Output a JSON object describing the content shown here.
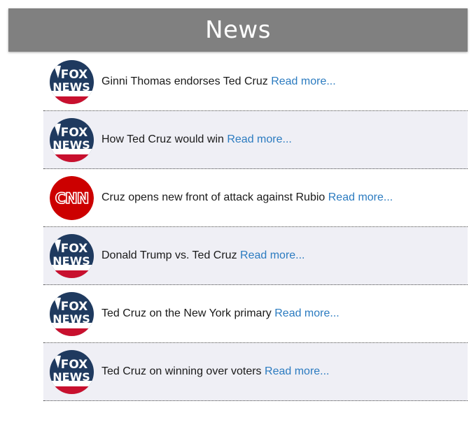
{
  "header": {
    "title": "News"
  },
  "news": [
    {
      "source": "fox-news-logo",
      "headline": "Ginni Thomas endorses Ted Cruz",
      "link_label": "Read more..."
    },
    {
      "source": "fox-news-logo",
      "headline": "How Ted Cruz would win",
      "link_label": "Read more..."
    },
    {
      "source": "cnn-logo",
      "headline": "Cruz opens new front of attack against Rubio",
      "link_label": "Read more..."
    },
    {
      "source": "fox-news-logo",
      "headline": "Donald Trump vs. Ted Cruz",
      "link_label": "Read more..."
    },
    {
      "source": "fox-news-logo",
      "headline": "Ted Cruz on the New York primary",
      "link_label": "Read more..."
    },
    {
      "source": "fox-news-logo",
      "headline": "Ted Cruz on winning over voters",
      "link_label": "Read more..."
    }
  ],
  "logos": {
    "fox": {
      "text_top": "FOX",
      "text_bottom": "NEWS",
      "bg": "#1f3a5f",
      "accent": "#c8102e"
    },
    "cnn": {
      "text": "CNN",
      "bg": "#cc0000"
    }
  },
  "colors": {
    "header_bg": "#808080",
    "link": "#2b7bc0",
    "alt_row": "#efeff5"
  }
}
